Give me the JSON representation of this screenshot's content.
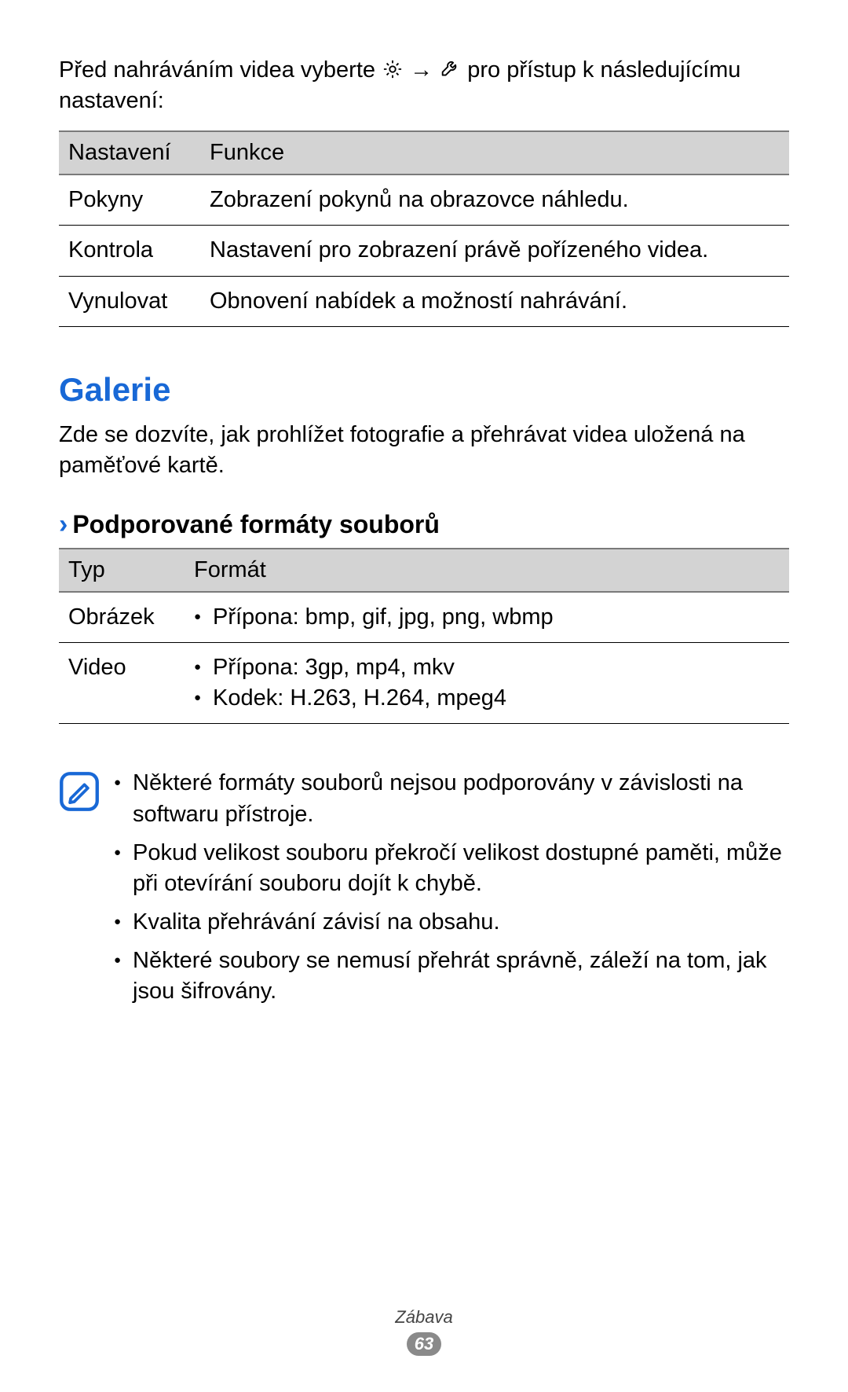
{
  "intro": {
    "before": "Před nahráváním videa vyberte ",
    "arrow": " → ",
    "after": " pro přístup k následujícímu nastavení:"
  },
  "settings_table": {
    "headers": [
      "Nastavení",
      "Funkce"
    ],
    "rows": [
      {
        "name": "Pokyny",
        "desc": "Zobrazení pokynů na obrazovce náhledu."
      },
      {
        "name": "Kontrola",
        "desc": "Nastavení pro zobrazení právě pořízeného videa."
      },
      {
        "name": "Vynulovat",
        "desc": "Obnovení nabídek a možností nahrávání."
      }
    ]
  },
  "section_title": "Galerie",
  "section_desc": "Zde se dozvíte, jak prohlížet fotografie a přehrávat videa uložená na paměťové kartě.",
  "subsection_title": "Podporované formáty souborů",
  "formats_table": {
    "headers": [
      "Typ",
      "Formát"
    ],
    "rows": [
      {
        "type": "Obrázek",
        "items": [
          "Přípona: bmp, gif, jpg, png, wbmp"
        ]
      },
      {
        "type": "Video",
        "items": [
          "Přípona: 3gp, mp4, mkv",
          "Kodek: H.263, H.264, mpeg4"
        ]
      }
    ]
  },
  "notes": [
    "Některé formáty souborů nejsou podporovány v závislosti na softwaru přístroje.",
    "Pokud velikost souboru překročí velikost dostupné paměti, může při otevírání souboru dojít k chybě.",
    "Kvalita přehrávání závisí na obsahu.",
    "Některé soubory se nemusí přehrát správně, záleží na tom, jak jsou šifrovány."
  ],
  "footer": {
    "category": "Zábava",
    "page": "63"
  }
}
